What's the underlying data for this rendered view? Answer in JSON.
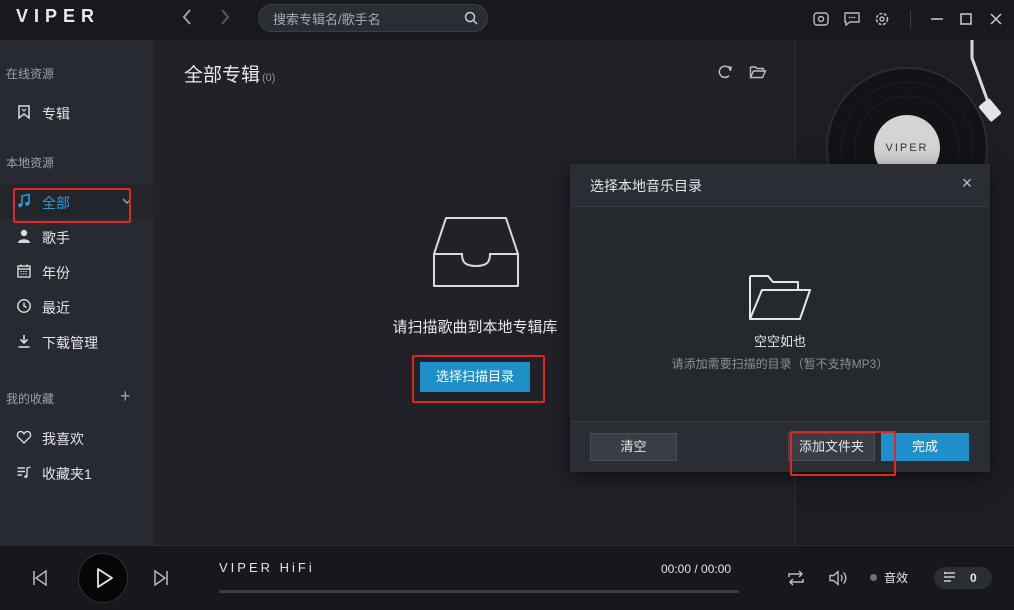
{
  "app": {
    "logo": "VIPER",
    "search": {
      "placeholder": "搜索专辑名/歌手名"
    }
  },
  "sidebar": {
    "online_section": "在线资源",
    "online_items": [
      {
        "label": "专辑",
        "icon": "bookmark-icon"
      }
    ],
    "local_section": "本地资源",
    "local_items": [
      {
        "label": "全部",
        "icon": "music-note-icon",
        "active": true
      },
      {
        "label": "歌手",
        "icon": "person-icon"
      },
      {
        "label": "年份",
        "icon": "calendar-icon"
      },
      {
        "label": "最近",
        "icon": "clock-icon"
      },
      {
        "label": "下载管理",
        "icon": "download-icon"
      }
    ],
    "favorites_section": "我的收藏",
    "favorites_add": "+",
    "favorite_items": [
      {
        "label": "我喜欢",
        "icon": "heart-icon"
      },
      {
        "label": "收藏夹1",
        "icon": "playlist-icon"
      }
    ]
  },
  "main": {
    "title": "全部专辑",
    "count": "(0)",
    "empty_hint": "请扫描歌曲到本地专辑库",
    "scan_button": "选择扫描目录"
  },
  "dialog": {
    "title": "选择本地音乐目录",
    "close": "×",
    "empty_title": "空空如也",
    "empty_subtitle": "请添加需要扫描的目录（暂不支持MP3）",
    "clear_button": "清空",
    "add_folder_button": "添加文件夹",
    "done_button": "完成"
  },
  "player": {
    "title": "VIPER HiFi",
    "time": "00:00 / 00:00",
    "progress": 0,
    "effects_label": "音效",
    "queue_count": "0"
  },
  "vinyl": {
    "label": "VIPER"
  },
  "colors": {
    "accent": "#1e8fc8",
    "highlight_box": "#e0281f"
  }
}
